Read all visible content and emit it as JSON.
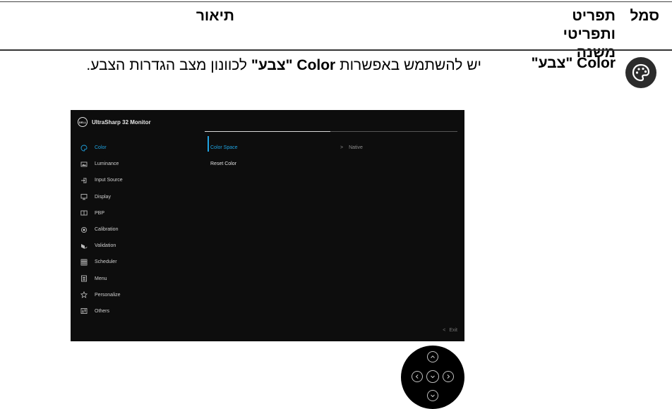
{
  "table": {
    "headers": {
      "symbol": "סמל",
      "item": "תפריט ותפריטי משנה",
      "description": "תיאור"
    },
    "row": {
      "icon": "palette-icon",
      "item": "Color \"צבע\"",
      "description_parts": [
        "יש להשתמש באפשרות ",
        "Color \"צבע\"",
        " לכוונון מצב הגדרות הצבע."
      ]
    }
  },
  "osd": {
    "title": "UltraSharp 32 Monitor",
    "logo_text": "DELL",
    "menu": [
      {
        "label": "Color",
        "icon": "palette-icon",
        "active": true
      },
      {
        "label": "Luminance",
        "icon": "brightness-icon"
      },
      {
        "label": "Input Source",
        "icon": "input-icon"
      },
      {
        "label": "Display",
        "icon": "display-icon"
      },
      {
        "label": "PBP",
        "icon": "pbp-icon"
      },
      {
        "label": "Calibration",
        "icon": "calibration-icon"
      },
      {
        "label": "Validation",
        "icon": "validation-icon"
      },
      {
        "label": "Scheduler",
        "icon": "scheduler-icon"
      },
      {
        "label": "Menu",
        "icon": "menu-icon"
      },
      {
        "label": "Personalize",
        "icon": "star-icon"
      },
      {
        "label": "Others",
        "icon": "others-icon"
      }
    ],
    "submenu": [
      "Color Space",
      "Reset Color"
    ],
    "value": "Native",
    "exit": "Exit",
    "accent": "#1fa3e1"
  }
}
